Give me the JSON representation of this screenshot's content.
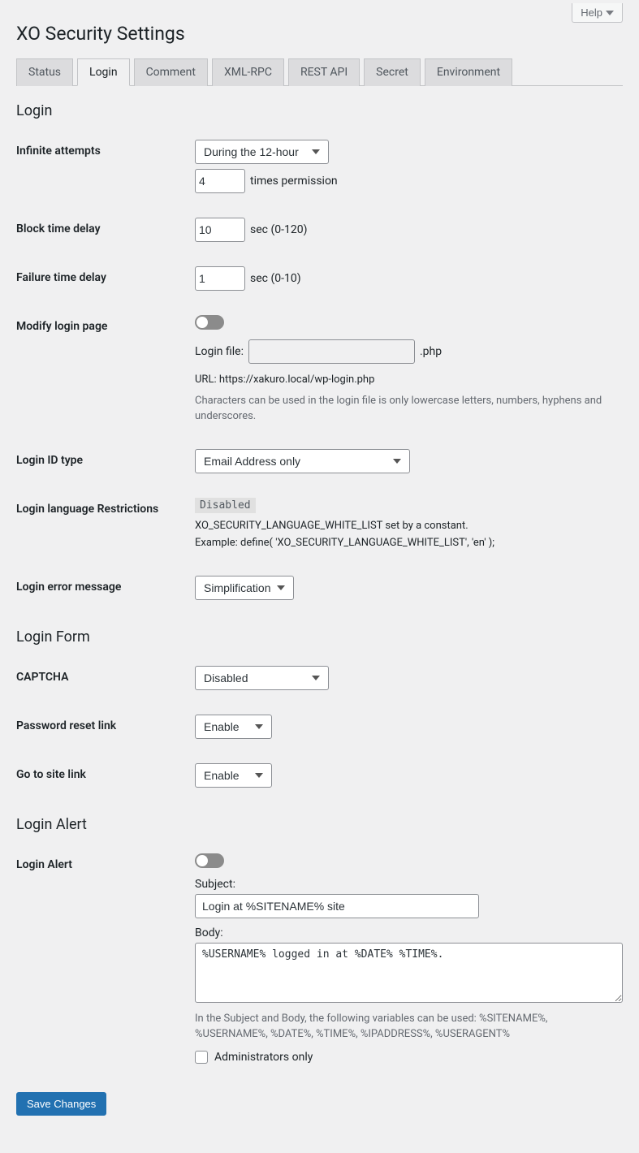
{
  "help_label": "Help",
  "page_title": "XO Security Settings",
  "tabs": [
    "Status",
    "Login",
    "Comment",
    "XML-RPC",
    "REST API",
    "Secret",
    "Environment"
  ],
  "active_tab": "Login",
  "section_login": "Login",
  "section_login_form": "Login Form",
  "section_login_alert": "Login Alert",
  "fields": {
    "infinite_attempts": {
      "label": "Infinite attempts",
      "select_value": "During the 12-hour",
      "number_value": "4",
      "suffix": "times permission"
    },
    "block_time_delay": {
      "label": "Block time delay",
      "value": "10",
      "suffix": "sec (0-120)"
    },
    "failure_time_delay": {
      "label": "Failure time delay",
      "value": "1",
      "suffix": "sec (0-10)"
    },
    "modify_login_page": {
      "label": "Modify login page",
      "login_file_label": "Login file:",
      "login_file_suffix": ".php",
      "url_label": "URL: https://xakuro.local/wp-login.php",
      "help_text": "Characters can be used in the login file is only lowercase letters, numbers, hyphens and underscores."
    },
    "login_id_type": {
      "label": "Login ID type",
      "value": "Email Address only"
    },
    "login_lang": {
      "label": "Login language Restrictions",
      "badge": "Disabled",
      "line1": "XO_SECURITY_LANGUAGE_WHITE_LIST set by a constant.",
      "line2": "Example: define( 'XO_SECURITY_LANGUAGE_WHITE_LIST', 'en' );"
    },
    "login_error_msg": {
      "label": "Login error message",
      "value": "Simplification"
    },
    "captcha": {
      "label": "CAPTCHA",
      "value": "Disabled"
    },
    "password_reset": {
      "label": "Password reset link",
      "value": "Enable"
    },
    "goto_site": {
      "label": "Go to site link",
      "value": "Enable"
    },
    "login_alert": {
      "label": "Login Alert",
      "subject_label": "Subject:",
      "subject_value": "Login at %SITENAME% site",
      "body_label": "Body:",
      "body_value": "%USERNAME% logged in at %DATE% %TIME%.",
      "help_text": "In the Subject and Body, the following variables can be used: %SITENAME%, %USERNAME%, %DATE%, %TIME%, %IPADDRESS%, %USERAGENT%",
      "admins_only": "Administrators only"
    }
  },
  "save_button": "Save Changes"
}
